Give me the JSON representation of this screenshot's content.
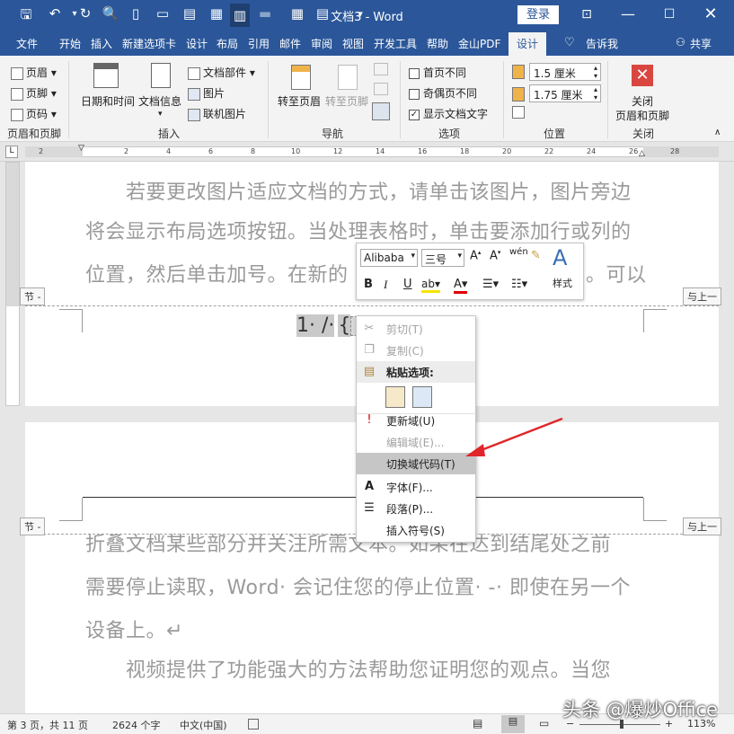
{
  "window": {
    "title": "文档3 - Word",
    "login_label": "登录"
  },
  "tabs": [
    "文件",
    "开始",
    "插入",
    "新建选项卡",
    "设计",
    "布局",
    "引用",
    "邮件",
    "审阅",
    "视图",
    "开发工具",
    "帮助",
    "金山PDF",
    "设计",
    "告诉我",
    "共享"
  ],
  "ribbon": {
    "header_footer": {
      "items": [
        "页眉",
        "页脚",
        "页码"
      ],
      "label": "页眉和页脚"
    },
    "insert": {
      "date_time": "日期和时间",
      "doc_info": "文档信息",
      "doc_parts": "文档部件",
      "picture": "图片",
      "online_picture": "联机图片",
      "label": "插入"
    },
    "navigation": {
      "goto_header": "转至页眉",
      "goto_footer": "转至页脚",
      "label": "导航"
    },
    "options": {
      "first_page": "首页不同",
      "odd_even": "奇偶页不同",
      "show_text": "显示文档文字",
      "label": "选项"
    },
    "position": {
      "header_dist": "1.5 厘米",
      "footer_dist": "1.75 厘米",
      "label": "位置"
    },
    "close": {
      "button": "关闭\n页眉和页脚",
      "line1": "关闭",
      "line2": "页眉和页脚",
      "label": "关闭"
    }
  },
  "ruler_ticks": [
    "2",
    "2",
    "4",
    "6",
    "8",
    "10",
    "12",
    "14",
    "16",
    "18",
    "20",
    "22",
    "24",
    "26",
    "28"
  ],
  "document": {
    "para1_line1": "若要更改图片适应文档的方式，请单击该图片，图片旁边",
    "para1_line2": "将会显示布局选项按钮。当处理表格时，单击要添加行或列的",
    "para1_line3a": "位置，然后单击加号。在新的",
    "para1_line3b": "。可以",
    "section_left": "节 -",
    "section_right": "与上一",
    "page_number": "1· /·",
    "para2_line1": "折叠文档某些部分并关注所需文本。如果在达到结尾处之前",
    "para2_line2": "需要停止读取，Word· 会记住您的停止位置· -· 即使在另一个",
    "para2_line3": "设备上。↵",
    "para3_line1": "视频提供了功能强大的方法帮助您证明您的观点。当您"
  },
  "minibar": {
    "font": "Alibaba",
    "size": "三号",
    "style_label": "样式",
    "buttons": [
      "B",
      "I",
      "U"
    ]
  },
  "context_menu": [
    {
      "label": "剪切(T)",
      "disabled": true,
      "icon": "scissors-icon"
    },
    {
      "label": "复制(C)",
      "disabled": true,
      "icon": "copy-icon"
    },
    {
      "label": "粘贴选项:",
      "disabled": false,
      "icon": "paste-icon"
    },
    {
      "label": "更新域(U)",
      "disabled": false,
      "icon": "update-field-icon"
    },
    {
      "label": "编辑域(E)...",
      "disabled": true,
      "icon": ""
    },
    {
      "label": "切换域代码(T)",
      "disabled": false,
      "icon": "",
      "highlighted": true
    },
    {
      "label": "字体(F)...",
      "disabled": false,
      "icon": "font-icon"
    },
    {
      "label": "段落(P)...",
      "disabled": false,
      "icon": "paragraph-icon"
    },
    {
      "label": "插入符号(S)",
      "disabled": false,
      "icon": ""
    }
  ],
  "status": {
    "page": "第 3 页，共 11 页",
    "words": "2624 个字",
    "lang": "中文(中国)",
    "zoom": "113%"
  },
  "watermark": "头条 @爆炒Office",
  "colors": {
    "brand": "#2b579a",
    "arrow": "#e0262a",
    "close_red": "#d9463f"
  }
}
